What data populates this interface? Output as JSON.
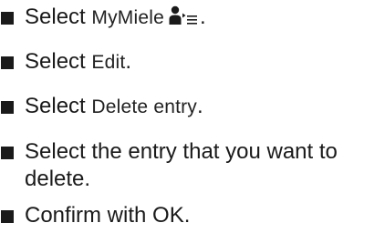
{
  "steps": [
    {
      "verb": "Select",
      "ui": "MyMiele",
      "icon": "person-menu-icon",
      "end": "."
    },
    {
      "verb": "Select",
      "ui": "Edit",
      "end": "."
    },
    {
      "verb": "Select",
      "ui": "Delete entry",
      "end": "."
    },
    {
      "line1": "Select the entry that you want to",
      "line2": "delete."
    },
    {
      "text": "Confirm with OK."
    }
  ]
}
